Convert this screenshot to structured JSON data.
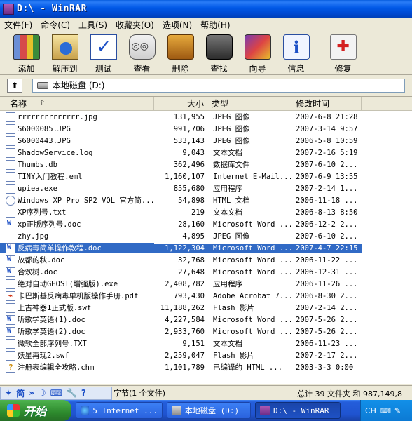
{
  "window": {
    "title": "D:\\ - WinRAR"
  },
  "menu": [
    "文件(F)",
    "命令(C)",
    "工具(S)",
    "收藏夹(O)",
    "选项(N)",
    "帮助(H)"
  ],
  "toolbar": [
    {
      "label": "添加",
      "icon": "add-archive-icon"
    },
    {
      "label": "解压到",
      "icon": "extract-icon"
    },
    {
      "label": "测试",
      "icon": "test-icon"
    },
    {
      "label": "查看",
      "icon": "view-icon"
    },
    {
      "label": "删除",
      "icon": "delete-icon"
    },
    {
      "label": "查找",
      "icon": "find-icon"
    },
    {
      "label": "向导",
      "icon": "wizard-icon"
    },
    {
      "label": "信息",
      "icon": "info-icon"
    },
    {
      "label": "修复",
      "icon": "repair-icon"
    }
  ],
  "address": {
    "value": "本地磁盘 (D:)"
  },
  "columns": {
    "name": "名称",
    "size": "大小",
    "type": "类型",
    "modified": "修改时间"
  },
  "files": [
    {
      "name": "rrrrrrrrrrrrrr.jpg",
      "size": "131,955",
      "type": "JPEG 图像",
      "modified": "2007-6-8 21:28",
      "icon": "jpg"
    },
    {
      "name": "S6000085.JPG",
      "size": "991,706",
      "type": "JPEG 图像",
      "modified": "2007-3-14 9:57",
      "icon": "jpg"
    },
    {
      "name": "S6000443.JPG",
      "size": "533,143",
      "type": "JPEG 图像",
      "modified": "2006-5-8 10:59",
      "icon": "jpg"
    },
    {
      "name": "ShadowService.log",
      "size": "9,043",
      "type": "文本文档",
      "modified": "2007-2-16 5:19",
      "icon": "log"
    },
    {
      "name": "Thumbs.db",
      "size": "362,496",
      "type": "数据库文件",
      "modified": "2007-6-10 2...",
      "icon": "db"
    },
    {
      "name": "TINY入门教程.eml",
      "size": "1,160,107",
      "type": "Internet E-Mail...",
      "modified": "2007-6-9 13:55",
      "icon": "eml"
    },
    {
      "name": "upiea.exe",
      "size": "855,680",
      "type": "应用程序",
      "modified": "2007-2-14 1...",
      "icon": "exe"
    },
    {
      "name": "Windows XP Pro SP2 VOL 官方简...",
      "size": "54,898",
      "type": "HTML 文档",
      "modified": "2006-11-18 ...",
      "icon": "htm"
    },
    {
      "name": "XP序列号.txt",
      "size": "219",
      "type": "文本文档",
      "modified": "2006-8-13 8:50",
      "icon": "txt"
    },
    {
      "name": "xp正版序列号.doc",
      "size": "28,160",
      "type": "Microsoft Word ...",
      "modified": "2006-12-2 2...",
      "icon": "doc"
    },
    {
      "name": "zhy.jpg",
      "size": "4,895",
      "type": "JPEG 图像",
      "modified": "2007-6-10 2...",
      "icon": "jpg"
    },
    {
      "name": "反病毒简单操作教程.doc",
      "size": "1,122,304",
      "type": "Microsoft Word ...",
      "modified": "2007-4-7 22:15",
      "icon": "doc",
      "selected": true
    },
    {
      "name": "故都的秋.doc",
      "size": "32,768",
      "type": "Microsoft Word ...",
      "modified": "2006-11-22 ...",
      "icon": "doc"
    },
    {
      "name": "合欢树.doc",
      "size": "27,648",
      "type": "Microsoft Word ...",
      "modified": "2006-12-31 ...",
      "icon": "doc"
    },
    {
      "name": "绝对自动GHOST(增强版).exe",
      "size": "2,408,782",
      "type": "应用程序",
      "modified": "2006-11-26 ...",
      "icon": "exe"
    },
    {
      "name": "卡巴斯基反病毒单机版操作手册.pdf",
      "size": "793,430",
      "type": "Adobe Acrobat 7...",
      "modified": "2006-8-30 2...",
      "icon": "pdf"
    },
    {
      "name": "上古神器1正式版.swf",
      "size": "11,188,262",
      "type": "Flash 影片",
      "modified": "2007-2-14 2...",
      "icon": "swf"
    },
    {
      "name": "听歌学英语(1).doc",
      "size": "4,227,584",
      "type": "Microsoft Word ...",
      "modified": "2007-5-26 2...",
      "icon": "doc"
    },
    {
      "name": "听歌学英语(2).doc",
      "size": "2,933,760",
      "type": "Microsoft Word ...",
      "modified": "2007-5-26 2...",
      "icon": "doc"
    },
    {
      "name": "微软全部序列号.TXT",
      "size": "9,151",
      "type": "文本文档",
      "modified": "2006-11-23 ...",
      "icon": "txt"
    },
    {
      "name": "妖星再现2.swf",
      "size": "2,259,047",
      "type": "Flash 影片",
      "modified": "2007-2-17 2...",
      "icon": "swf"
    },
    {
      "name": "注册表编辑全攻略.chm",
      "size": "1,101,789",
      "type": "已编译的 HTML ...",
      "modified": "2003-3-3 0:00",
      "icon": "chm"
    }
  ],
  "status": {
    "left": "字节(1 个文件)",
    "right": "总计 39 文件夹 和 987,149,8"
  },
  "ime": {
    "glyph1": "✦",
    "glyph2": "简",
    "glyph3": "»",
    "glyph4": "☽"
  },
  "taskbar": {
    "start": "开始",
    "tasks": [
      "5 Internet ...",
      "本地磁盘 (D:)",
      "D:\\ - WinRAR"
    ],
    "lang": "CH"
  }
}
